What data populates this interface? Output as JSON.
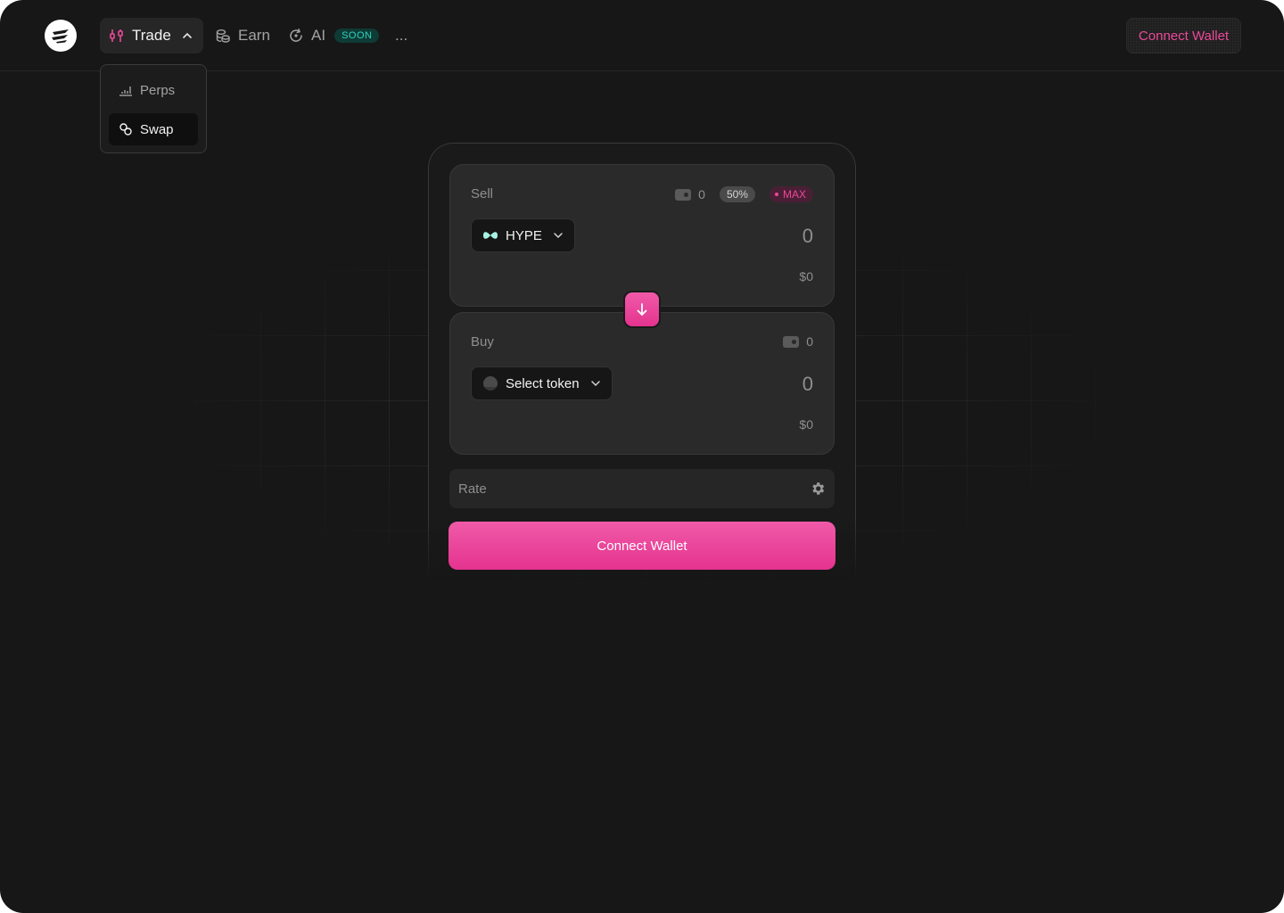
{
  "header": {
    "nav": {
      "trade_label": "Trade",
      "earn_label": "Earn",
      "ai_label": "AI",
      "ai_badge": "SOON",
      "more_label": "..."
    },
    "connect_wallet_label": "Connect Wallet"
  },
  "trade_menu": {
    "items": [
      {
        "label": "Perps",
        "icon": "chart-icon"
      },
      {
        "label": "Swap",
        "icon": "swap-icon",
        "active": true
      }
    ]
  },
  "swap": {
    "sell": {
      "label": "Sell",
      "balance": "0",
      "half_label": "50%",
      "max_label": "MAX",
      "token": "HYPE",
      "amount_placeholder": "0",
      "usd_value": "$0"
    },
    "buy": {
      "label": "Buy",
      "balance": "0",
      "token": "Select token",
      "amount_placeholder": "0",
      "usd_value": "$0"
    },
    "rate_label": "Rate",
    "connect_wallet_label": "Connect Wallet"
  },
  "colors": {
    "accent": "#ec4899",
    "badge_teal": "#2dd4bf",
    "background": "#171717",
    "panel": "#2a2a2a"
  }
}
